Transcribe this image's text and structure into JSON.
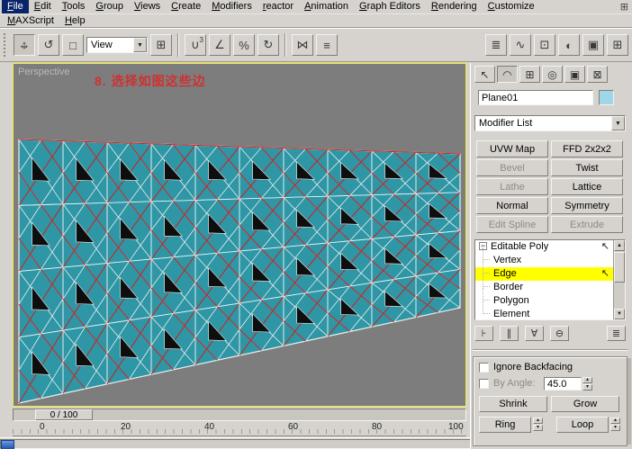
{
  "menubar": {
    "items": [
      "File",
      "Edit",
      "Tools",
      "Group",
      "Views",
      "Create",
      "Modifiers",
      "reactor",
      "Animation",
      "Graph Editors",
      "Rendering",
      "Customize"
    ],
    "row2": [
      "MAXScript",
      "Help"
    ]
  },
  "toolbar": {
    "view_combo": "View"
  },
  "viewport": {
    "label": "Perspective",
    "annotation": "8. 选择如图这些边"
  },
  "command_panel": {
    "object_name": "Plane01",
    "modifier_list": "Modifier List",
    "modifier_buttons": [
      {
        "label": "UVW Map",
        "enabled": true
      },
      {
        "label": "FFD 2x2x2",
        "enabled": true
      },
      {
        "label": "Bevel",
        "enabled": false
      },
      {
        "label": "Twist",
        "enabled": true
      },
      {
        "label": "Lathe",
        "enabled": false
      },
      {
        "label": "Lattice",
        "enabled": true
      },
      {
        "label": "Normal",
        "enabled": true
      },
      {
        "label": "Symmetry",
        "enabled": true
      },
      {
        "label": "Edit Spline",
        "enabled": false
      },
      {
        "label": "Extrude",
        "enabled": false
      }
    ],
    "stack": {
      "root": "Editable Poly",
      "items": [
        "Vertex",
        "Edge",
        "Border",
        "Polygon",
        "Element"
      ],
      "selected": "Edge"
    },
    "selection": {
      "ignore_backfacing": "Ignore Backfacing",
      "by_angle": "By Angle:",
      "angle_value": "45.0",
      "shrink": "Shrink",
      "grow": "Grow",
      "ring": "Ring",
      "loop": "Loop"
    }
  },
  "timeline": {
    "slider": "0 / 100",
    "ticks": [
      "0",
      "20",
      "40",
      "60",
      "80",
      "100"
    ]
  },
  "icons": {
    "dropdown_arrow": "▼",
    "up_arrow": "▲",
    "down_arrow": "▼",
    "spin_up": "▴",
    "spin_down": "▾",
    "arrow_h": "↔",
    "arrow_v": "↕",
    "rotate": "↺",
    "scale": "□",
    "window_grid": "⊞",
    "magnet": "∪",
    "three": "3",
    "angle_snap": "∠",
    "percent_snap": "%",
    "spinner_snap": "↻",
    "mirror": "⋈",
    "align": "≡",
    "layers": "≣",
    "curve_editor": "∿",
    "schematic": "⊡",
    "material_editor": "◐",
    "render": "▣",
    "create_tab": "↖",
    "modify_tab": "◠",
    "hierarchy_tab": "⊞",
    "motion_tab": "◎",
    "display_tab": "▣",
    "utilities_tab": "⊠",
    "expander_minus": "−",
    "cursor": "↖",
    "pin_stack": "⊦",
    "show_end_result": "∥",
    "make_unique": "∀",
    "remove_modifier": "⊖",
    "configure_sets": "≣"
  },
  "colors": {
    "mesh_teal": "#2e96a5",
    "wire_white": "#e9efef",
    "selected_edge_red": "#cc2020",
    "hole_black": "#0e0e0e",
    "viewport_bg": "#7d7d7d",
    "active_border_yellow": "#f5ef2a",
    "annotation_red": "#d03030",
    "object_color_swatch": "#9fd6e8",
    "highlight_yellow": "#ffff00"
  }
}
